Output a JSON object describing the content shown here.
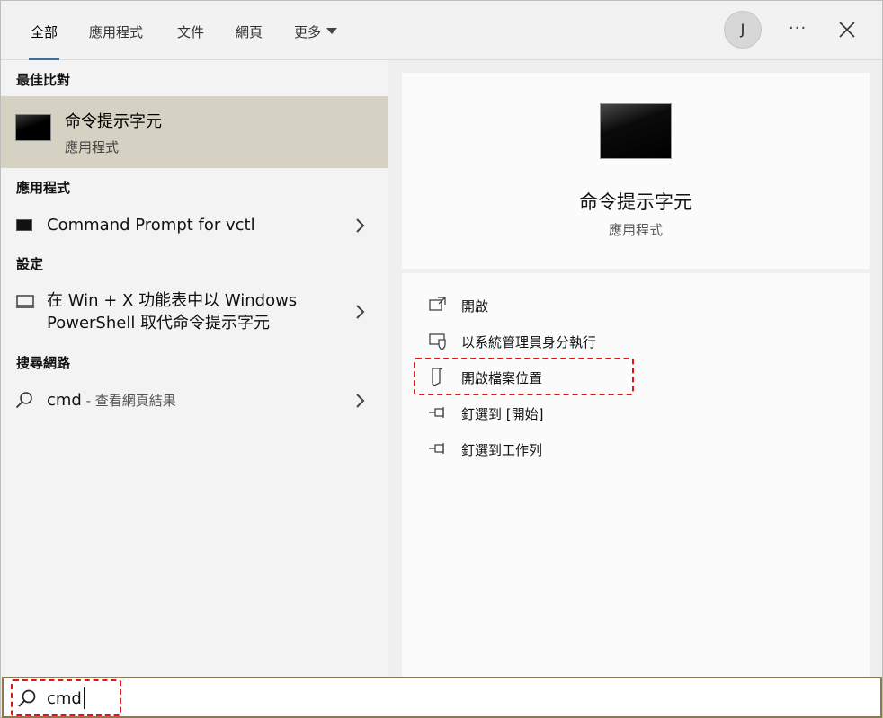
{
  "tabs": [
    {
      "label": "全部"
    },
    {
      "label": "應用程式"
    },
    {
      "label": "文件"
    },
    {
      "label": "網頁"
    },
    {
      "label": "更多"
    }
  ],
  "account": {
    "initial": "J"
  },
  "header": {
    "more_label": "···"
  },
  "left": {
    "best_match_label": "最佳比對",
    "best_match": {
      "title": "命令提示字元",
      "subtitle": "應用程式"
    },
    "apps_label": "應用程式",
    "apps": [
      {
        "title": "Command Prompt for vctl"
      }
    ],
    "settings_label": "設定",
    "settings": [
      {
        "line1": "在 Win + X 功能表中以 Windows",
        "line2": "PowerShell 取代命令提示字元"
      }
    ],
    "web_label": "搜尋網路",
    "web": [
      {
        "query": "cmd",
        "suffix": " - 查看網頁結果"
      }
    ]
  },
  "right": {
    "title": "命令提示字元",
    "subtitle": "應用程式",
    "actions": [
      {
        "label": "開啟",
        "icon": "open-icon"
      },
      {
        "label": "以系統管理員身分執行",
        "icon": "shield-icon"
      },
      {
        "label": "開啟檔案位置",
        "icon": "folder-location-icon",
        "highlighted": true
      },
      {
        "label": "釘選到 [開始]",
        "icon": "pin-icon"
      },
      {
        "label": "釘選到工作列",
        "icon": "pin-icon"
      }
    ]
  },
  "search": {
    "value": "cmd",
    "highlighted": true
  },
  "colors": {
    "highlight_dash": "#e0141c",
    "best_match_bg": "#d6d2c3",
    "searchbar_border": "#8c7a48"
  }
}
